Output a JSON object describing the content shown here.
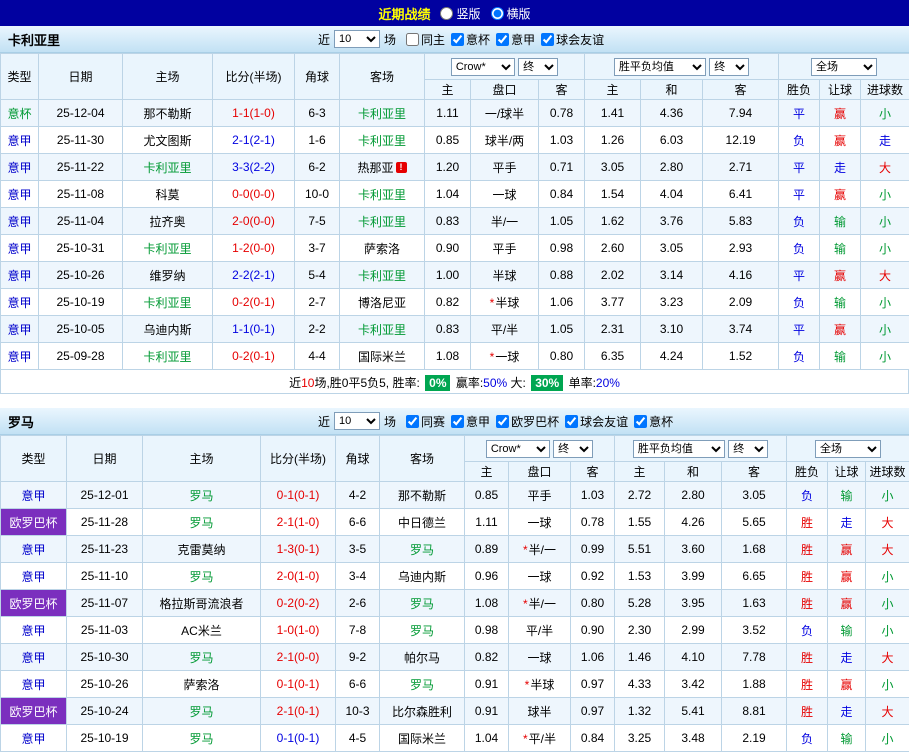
{
  "topbar": {
    "title": "近期战绩",
    "layout_options": [
      {
        "key": "vertical",
        "label": "竖版",
        "selected": false
      },
      {
        "key": "horizontal",
        "label": "横版",
        "selected": true
      }
    ]
  },
  "table_header": {
    "type": "类型",
    "date": "日期",
    "home": "主场",
    "score": "比分(半场)",
    "corner": "角球",
    "away": "客场",
    "odds_source": "Crow*",
    "final": "终",
    "odds_home": "主",
    "handicap": "盘口",
    "odds_away": "客",
    "avg_label": "胜平负均值",
    "avg_home": "主",
    "avg_draw": "和",
    "avg_away": "客",
    "scope": "全场",
    "result": "胜负",
    "cover": "让球",
    "goals": "进球数"
  },
  "colors": {
    "topbar_bg": "#0101a0",
    "title_text": "#ffff00",
    "europa_bg": "#7b2fbe",
    "focal_team": "#009933",
    "serie_a_text": "#0000cc",
    "cup_text": "#009933",
    "win_red": "#e60000",
    "loss_blue": "#0000e0",
    "draw_green": "#009933",
    "badge_green": "#00a651"
  },
  "sections": [
    {
      "team": "卡利亚里",
      "near_label": "近",
      "count": "10",
      "games_label": "场",
      "filters": [
        {
          "key": "same-venue",
          "label": "同主",
          "checked": false
        },
        {
          "key": "coppa-italia",
          "label": "意杯",
          "checked": true
        },
        {
          "key": "serie-a",
          "label": "意甲",
          "checked": true
        },
        {
          "key": "club-friendly",
          "label": "球会友谊",
          "checked": true
        }
      ],
      "rows": [
        {
          "league": "意杯",
          "league_class": "cup",
          "date": "25-12-04",
          "home": "那不勒斯",
          "score": "1-1(1-0)",
          "score_color": "red",
          "corner": "6-3",
          "away": "卡利亚里",
          "away_focal": true,
          "odds_home": "1.11",
          "handicap": "一/球半",
          "odds_away": "0.78",
          "avg_home": "1.41",
          "avg_draw": "4.36",
          "avg_away": "7.94",
          "result": "平",
          "result_color": "blue",
          "cover": "赢",
          "cover_color": "red",
          "goals": "小",
          "goals_color": "green"
        },
        {
          "league": "意甲",
          "league_class": "serie",
          "date": "25-11-30",
          "home": "尤文图斯",
          "score": "2-1(2-1)",
          "score_color": "blue",
          "corner": "1-6",
          "away": "卡利亚里",
          "away_focal": true,
          "odds_home": "0.85",
          "handicap": "球半/两",
          "odds_away": "1.03",
          "avg_home": "1.26",
          "avg_draw": "6.03",
          "avg_away": "12.19",
          "result": "负",
          "result_color": "blue",
          "cover": "赢",
          "cover_color": "red",
          "goals": "走",
          "goals_color": "blue"
        },
        {
          "league": "意甲",
          "league_class": "serie",
          "date": "25-11-22",
          "home": "卡利亚里",
          "home_focal": true,
          "score": "3-3(2-2)",
          "score_color": "blue",
          "corner": "6-2",
          "away": "热那亚",
          "away_alert": true,
          "odds_home": "1.20",
          "handicap": "平手",
          "odds_away": "0.71",
          "avg_home": "3.05",
          "avg_draw": "2.80",
          "avg_away": "2.71",
          "result": "平",
          "result_color": "blue",
          "cover": "走",
          "cover_color": "blue",
          "goals": "大",
          "goals_color": "red"
        },
        {
          "league": "意甲",
          "league_class": "serie",
          "date": "25-11-08",
          "home": "科莫",
          "score": "0-0(0-0)",
          "score_color": "red",
          "corner": "10-0",
          "away": "卡利亚里",
          "away_focal": true,
          "odds_home": "1.04",
          "handicap": "一球",
          "odds_away": "0.84",
          "avg_home": "1.54",
          "avg_draw": "4.04",
          "avg_away": "6.41",
          "result": "平",
          "result_color": "blue",
          "cover": "赢",
          "cover_color": "red",
          "goals": "小",
          "goals_color": "green"
        },
        {
          "league": "意甲",
          "league_class": "serie",
          "date": "25-11-04",
          "home": "拉齐奥",
          "score": "2-0(0-0)",
          "score_color": "red",
          "corner": "7-5",
          "away": "卡利亚里",
          "away_focal": true,
          "odds_home": "0.83",
          "handicap": "半/一",
          "odds_away": "1.05",
          "avg_home": "1.62",
          "avg_draw": "3.76",
          "avg_away": "5.83",
          "result": "负",
          "result_color": "blue",
          "cover": "输",
          "cover_color": "green",
          "goals": "小",
          "goals_color": "green"
        },
        {
          "league": "意甲",
          "league_class": "serie",
          "date": "25-10-31",
          "home": "卡利亚里",
          "home_focal": true,
          "score": "1-2(0-0)",
          "score_color": "red",
          "corner": "3-7",
          "away": "萨索洛",
          "odds_home": "0.90",
          "handicap": "平手",
          "odds_away": "0.98",
          "avg_home": "2.60",
          "avg_draw": "3.05",
          "avg_away": "2.93",
          "result": "负",
          "result_color": "blue",
          "cover": "输",
          "cover_color": "green",
          "goals": "小",
          "goals_color": "green"
        },
        {
          "league": "意甲",
          "league_class": "serie",
          "date": "25-10-26",
          "home": "维罗纳",
          "score": "2-2(2-1)",
          "score_color": "blue",
          "corner": "5-4",
          "away": "卡利亚里",
          "away_focal": true,
          "odds_home": "1.00",
          "handicap": "半球",
          "odds_away": "0.88",
          "avg_home": "2.02",
          "avg_draw": "3.14",
          "avg_away": "4.16",
          "result": "平",
          "result_color": "blue",
          "cover": "赢",
          "cover_color": "red",
          "goals": "大",
          "goals_color": "red"
        },
        {
          "league": "意甲",
          "league_class": "serie",
          "date": "25-10-19",
          "home": "卡利亚里",
          "home_focal": true,
          "score": "0-2(0-1)",
          "score_color": "red",
          "corner": "2-7",
          "away": "博洛尼亚",
          "odds_home": "0.82",
          "handicap": "半球",
          "handicap_star": true,
          "odds_away": "1.06",
          "avg_home": "3.77",
          "avg_draw": "3.23",
          "avg_away": "2.09",
          "result": "负",
          "result_color": "blue",
          "cover": "输",
          "cover_color": "green",
          "goals": "小",
          "goals_color": "green"
        },
        {
          "league": "意甲",
          "league_class": "serie",
          "date": "25-10-05",
          "home": "乌迪内斯",
          "score": "1-1(0-1)",
          "score_color": "blue",
          "corner": "2-2",
          "away": "卡利亚里",
          "away_focal": true,
          "odds_home": "0.83",
          "handicap": "平/半",
          "odds_away": "1.05",
          "avg_home": "2.31",
          "avg_draw": "3.10",
          "avg_away": "3.74",
          "result": "平",
          "result_color": "blue",
          "cover": "赢",
          "cover_color": "red",
          "goals": "小",
          "goals_color": "green"
        },
        {
          "league": "意甲",
          "league_class": "serie",
          "date": "25-09-28",
          "home": "卡利亚里",
          "home_focal": true,
          "score": "0-2(0-1)",
          "score_color": "red",
          "corner": "4-4",
          "away": "国际米兰",
          "odds_home": "1.08",
          "handicap": "一球",
          "handicap_star": true,
          "odds_away": "0.80",
          "avg_home": "6.35",
          "avg_draw": "4.24",
          "avg_away": "1.52",
          "result": "负",
          "result_color": "blue",
          "cover": "输",
          "cover_color": "green",
          "goals": "小",
          "goals_color": "green"
        }
      ],
      "summary": {
        "p1": "近",
        "count": "10",
        "p2": "场,胜0平5负5, 胜率: ",
        "win_rate": "0%",
        "p3": " 赢率:",
        "cover_rate": "50%",
        "p4": " 大: ",
        "over_rate": "30%",
        "p5": " 单率:",
        "single_rate": "20%"
      }
    },
    {
      "team": "罗马",
      "near_label": "近",
      "count": "10",
      "games_label": "场",
      "filters": [
        {
          "key": "same-competition",
          "label": "同赛",
          "checked": true
        },
        {
          "key": "serie-a",
          "label": "意甲",
          "checked": true
        },
        {
          "key": "europa-league",
          "label": "欧罗巴杯",
          "checked": true
        },
        {
          "key": "club-friendly",
          "label": "球会友谊",
          "checked": true
        },
        {
          "key": "coppa-italia",
          "label": "意杯",
          "checked": true
        }
      ],
      "rows": [
        {
          "league": "意甲",
          "league_class": "serie",
          "date": "25-12-01",
          "home": "罗马",
          "home_focal": true,
          "score": "0-1(0-1)",
          "score_color": "red",
          "corner": "4-2",
          "away": "那不勒斯",
          "odds_home": "0.85",
          "handicap": "平手",
          "odds_away": "1.03",
          "avg_home": "2.72",
          "avg_draw": "2.80",
          "avg_away": "3.05",
          "result": "负",
          "result_color": "blue",
          "cover": "输",
          "cover_color": "green",
          "goals": "小",
          "goals_color": "green"
        },
        {
          "league": "欧罗巴杯",
          "league_class": "europa",
          "date": "25-11-28",
          "home": "罗马",
          "home_focal": true,
          "score": "2-1(1-0)",
          "score_color": "red",
          "corner": "6-6",
          "away": "中日德兰",
          "odds_home": "1.11",
          "handicap": "一球",
          "odds_away": "0.78",
          "avg_home": "1.55",
          "avg_draw": "4.26",
          "avg_away": "5.65",
          "result": "胜",
          "result_color": "red",
          "cover": "走",
          "cover_color": "blue",
          "goals": "大",
          "goals_color": "red"
        },
        {
          "league": "意甲",
          "league_class": "serie",
          "date": "25-11-23",
          "home": "克雷莫纳",
          "score": "1-3(0-1)",
          "score_color": "red",
          "corner": "3-5",
          "away": "罗马",
          "away_focal": true,
          "odds_home": "0.89",
          "handicap": "半/一",
          "handicap_star": true,
          "odds_away": "0.99",
          "avg_home": "5.51",
          "avg_draw": "3.60",
          "avg_away": "1.68",
          "result": "胜",
          "result_color": "red",
          "cover": "赢",
          "cover_color": "red",
          "goals": "大",
          "goals_color": "red"
        },
        {
          "league": "意甲",
          "league_class": "serie",
          "date": "25-11-10",
          "home": "罗马",
          "home_focal": true,
          "score": "2-0(1-0)",
          "score_color": "red",
          "corner": "3-4",
          "away": "乌迪内斯",
          "odds_home": "0.96",
          "handicap": "一球",
          "odds_away": "0.92",
          "avg_home": "1.53",
          "avg_draw": "3.99",
          "avg_away": "6.65",
          "result": "胜",
          "result_color": "red",
          "cover": "赢",
          "cover_color": "red",
          "goals": "小",
          "goals_color": "green"
        },
        {
          "league": "欧罗巴杯",
          "league_class": "europa",
          "date": "25-11-07",
          "home": "格拉斯哥流浪者",
          "score": "0-2(0-2)",
          "score_color": "red",
          "corner": "2-6",
          "away": "罗马",
          "away_focal": true,
          "odds_home": "1.08",
          "handicap": "半/一",
          "handicap_star": true,
          "odds_away": "0.80",
          "avg_home": "5.28",
          "avg_draw": "3.95",
          "avg_away": "1.63",
          "result": "胜",
          "result_color": "red",
          "cover": "赢",
          "cover_color": "red",
          "goals": "小",
          "goals_color": "green"
        },
        {
          "league": "意甲",
          "league_class": "serie",
          "date": "25-11-03",
          "home": "AC米兰",
          "score": "1-0(1-0)",
          "score_color": "red",
          "corner": "7-8",
          "away": "罗马",
          "away_focal": true,
          "odds_home": "0.98",
          "handicap": "平/半",
          "odds_away": "0.90",
          "avg_home": "2.30",
          "avg_draw": "2.99",
          "avg_away": "3.52",
          "result": "负",
          "result_color": "blue",
          "cover": "输",
          "cover_color": "green",
          "goals": "小",
          "goals_color": "green"
        },
        {
          "league": "意甲",
          "league_class": "serie",
          "date": "25-10-30",
          "home": "罗马",
          "home_focal": true,
          "score": "2-1(0-0)",
          "score_color": "red",
          "corner": "9-2",
          "away": "帕尔马",
          "odds_home": "0.82",
          "handicap": "一球",
          "odds_away": "1.06",
          "avg_home": "1.46",
          "avg_draw": "4.10",
          "avg_away": "7.78",
          "result": "胜",
          "result_color": "red",
          "cover": "走",
          "cover_color": "blue",
          "goals": "大",
          "goals_color": "red"
        },
        {
          "league": "意甲",
          "league_class": "serie",
          "date": "25-10-26",
          "home": "萨索洛",
          "score": "0-1(0-1)",
          "score_color": "red",
          "corner": "6-6",
          "away": "罗马",
          "away_focal": true,
          "odds_home": "0.91",
          "handicap": "半球",
          "handicap_star": true,
          "odds_away": "0.97",
          "avg_home": "4.33",
          "avg_draw": "3.42",
          "avg_away": "1.88",
          "result": "胜",
          "result_color": "red",
          "cover": "赢",
          "cover_color": "red",
          "goals": "小",
          "goals_color": "green"
        },
        {
          "league": "欧罗巴杯",
          "league_class": "europa",
          "date": "25-10-24",
          "home": "罗马",
          "home_focal": true,
          "score": "2-1(0-1)",
          "score_color": "red",
          "corner": "10-3",
          "away": "比尔森胜利",
          "odds_home": "0.91",
          "handicap": "球半",
          "odds_away": "0.97",
          "avg_home": "1.32",
          "avg_draw": "5.41",
          "avg_away": "8.81",
          "result": "胜",
          "result_color": "red",
          "cover": "走",
          "cover_color": "blue",
          "goals": "大",
          "goals_color": "red"
        },
        {
          "league": "意甲",
          "league_class": "serie",
          "date": "25-10-19",
          "home": "罗马",
          "home_focal": true,
          "score": "0-1(0-1)",
          "score_color": "blue",
          "corner": "4-5",
          "away": "国际米兰",
          "odds_home": "1.04",
          "handicap": "平/半",
          "handicap_star": true,
          "odds_away": "0.84",
          "avg_home": "3.25",
          "avg_draw": "3.48",
          "avg_away": "2.19",
          "result": "负",
          "result_color": "blue",
          "cover": "输",
          "cover_color": "green",
          "goals": "小",
          "goals_color": "green"
        }
      ]
    }
  ]
}
